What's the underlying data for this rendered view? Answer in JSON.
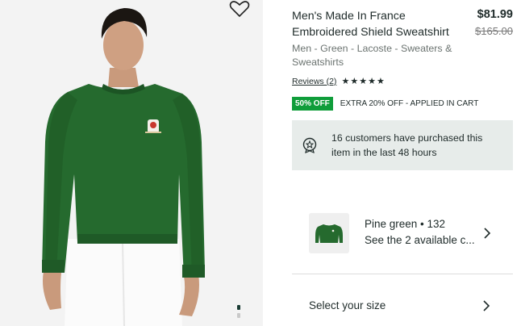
{
  "product": {
    "title": "Men's Made In France Embroidered Shield Sweatshirt",
    "price_current": "$81.99",
    "price_original": "$165.00",
    "breadcrumb": "Men - Green - Lacoste - Sweaters & Sweatshirts",
    "reviews_label": "Reviews (2)",
    "rating": 5,
    "promo_badge": "50% OFF",
    "promo_text": "EXTRA 20% OFF - APPLIED IN CART",
    "purchase_note": "16 customers have purchased this item in the last 48 hours"
  },
  "color": {
    "name_line": "Pine green • 132",
    "available_line": "See the 2 available c..."
  },
  "size": {
    "label": "Select your size"
  },
  "gallery": {
    "current_index": 1,
    "total_visible_dots": 2
  },
  "colors": {
    "sweatshirt": "#256a2e",
    "promo_badge": "#0f9d3a",
    "info_box": "#e7ecea",
    "text": "#1f2b2a"
  },
  "icons": {
    "wishlist": "heart-outline-icon",
    "purchase": "badge-star-icon",
    "chevron": "chevron-right-icon"
  }
}
